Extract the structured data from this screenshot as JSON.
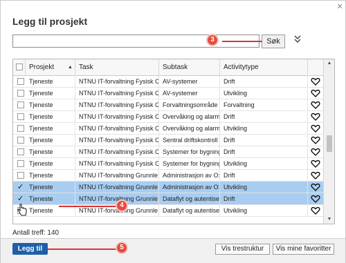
{
  "dialog": {
    "title": "Legg til prosjekt",
    "close_glyph": "✕"
  },
  "search": {
    "value": "",
    "placeholder": "",
    "button_label": "Søk",
    "expand_icon": "double-chevron-down-icon"
  },
  "table": {
    "columns": [
      "Prosjekt",
      "Task",
      "Subtask",
      "Activitytype"
    ],
    "sort_glyph": "▲",
    "rows": [
      {
        "prosjekt": "Tjeneste",
        "task": "NTNU IT-forvaltning Fysisk C",
        "subtask": "AV-systemer",
        "activity": "Drift",
        "checked": false,
        "selected": false
      },
      {
        "prosjekt": "Tjeneste",
        "task": "NTNU IT-forvaltning Fysisk C",
        "subtask": "AV-systemer",
        "activity": "Utvikling",
        "checked": false,
        "selected": false
      },
      {
        "prosjekt": "Tjeneste",
        "task": "NTNU IT-forvaltning Fysisk C",
        "subtask": "Forvaltningsområde",
        "activity": "Forvaltning",
        "checked": false,
        "selected": false
      },
      {
        "prosjekt": "Tjeneste",
        "task": "NTNU IT-forvaltning Fysisk C",
        "subtask": "Overvåking og alarm",
        "activity": "Drift",
        "checked": false,
        "selected": false
      },
      {
        "prosjekt": "Tjeneste",
        "task": "NTNU IT-forvaltning Fysisk C",
        "subtask": "Overvåking og alarm",
        "activity": "Utvikling",
        "checked": false,
        "selected": false
      },
      {
        "prosjekt": "Tjeneste",
        "task": "NTNU IT-forvaltning Fysisk C",
        "subtask": "Sentral driftskontroll",
        "activity": "Drift",
        "checked": false,
        "selected": false
      },
      {
        "prosjekt": "Tjeneste",
        "task": "NTNU IT-forvaltning Fysisk C",
        "subtask": "Systemer for bygning",
        "activity": "Drift",
        "checked": false,
        "selected": false
      },
      {
        "prosjekt": "Tjeneste",
        "task": "NTNU IT-forvaltning Fysisk C",
        "subtask": "Systemer for bygning",
        "activity": "Utvikling",
        "checked": false,
        "selected": false
      },
      {
        "prosjekt": "Tjeneste",
        "task": "NTNU IT-forvaltning Grunnle",
        "subtask": "Administrasjon av O:",
        "activity": "Drift",
        "checked": false,
        "selected": false
      },
      {
        "prosjekt": "Tjeneste",
        "task": "NTNU IT-forvaltning Grunnle",
        "subtask": "Administrasjon av O:",
        "activity": "Utvikling",
        "checked": true,
        "selected": true
      },
      {
        "prosjekt": "Tjeneste",
        "task": "NTNU IT-forvaltning Grunnle",
        "subtask": "Dataflyt og autentise",
        "activity": "Drift",
        "checked": true,
        "selected": true
      },
      {
        "prosjekt": "Tjeneste",
        "task": "NTNU IT-forvaltning Grunnle",
        "subtask": "Dataflyt og autentise",
        "activity": "Utvikling",
        "checked": false,
        "selected": false
      }
    ]
  },
  "status": {
    "count_text": "Antall treff: 140"
  },
  "footer": {
    "add_label": "Legg til",
    "tree_label": "Vis trestruktur",
    "favorites_label": "Vis mine favoritter"
  },
  "annotations": {
    "marker_3": "3",
    "marker_4": "4",
    "marker_5": "5"
  },
  "colors": {
    "selected_row": "#a8cdf0",
    "primary_button": "#1f5fa8",
    "annotation_red": "#e74c3c"
  }
}
